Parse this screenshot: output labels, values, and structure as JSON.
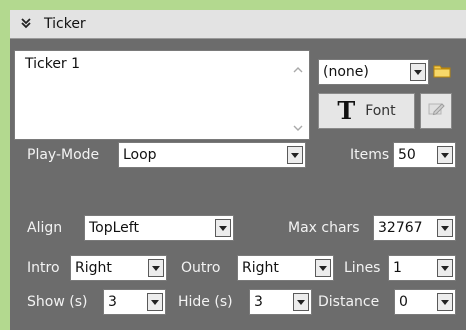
{
  "panel": {
    "title": "Ticker",
    "collapse_icon": "chevron-double-down-icon"
  },
  "ticker_text": "Ticker 1",
  "source": {
    "value": "(none)",
    "folder_icon": "folder-icon"
  },
  "font_button": {
    "icon": "font-T-icon",
    "label": "Font"
  },
  "edit_button": {
    "icon": "edit-icon"
  },
  "play_mode": {
    "label": "Play-Mode",
    "value": "Loop"
  },
  "items": {
    "label": "Items",
    "value": "50"
  },
  "align": {
    "label": "Align",
    "value": "TopLeft"
  },
  "max_chars": {
    "label": "Max chars",
    "value": "32767"
  },
  "intro": {
    "label": "Intro",
    "value": "Right"
  },
  "outro": {
    "label": "Outro",
    "value": "Right"
  },
  "lines": {
    "label": "Lines",
    "value": "1"
  },
  "show": {
    "label": "Show (s)",
    "value": "3"
  },
  "hide": {
    "label": "Hide (s)",
    "value": "3"
  },
  "distance": {
    "label": "Distance",
    "value": "0"
  },
  "colors": {
    "background": "#b3d98f",
    "panel": "#6c6c6c",
    "header": "#e3e3e3"
  }
}
